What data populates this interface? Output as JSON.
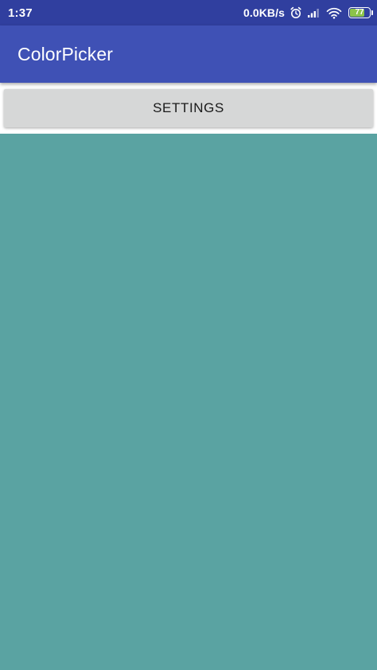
{
  "status_bar": {
    "time": "1:37",
    "net_speed": "0.0KB/s",
    "battery_level": "77",
    "icons": [
      "alarm-icon",
      "signal-icon",
      "wifi-icon",
      "battery-icon"
    ]
  },
  "app_bar": {
    "title": "ColorPicker"
  },
  "main": {
    "settings_label": "SETTINGS",
    "preview_color": "#5aa3a2"
  },
  "colors": {
    "status_bar": "#303f9f",
    "app_bar": "#3f51b5",
    "button_bg": "#d6d7d7",
    "battery_fill": "#8bc34a"
  }
}
